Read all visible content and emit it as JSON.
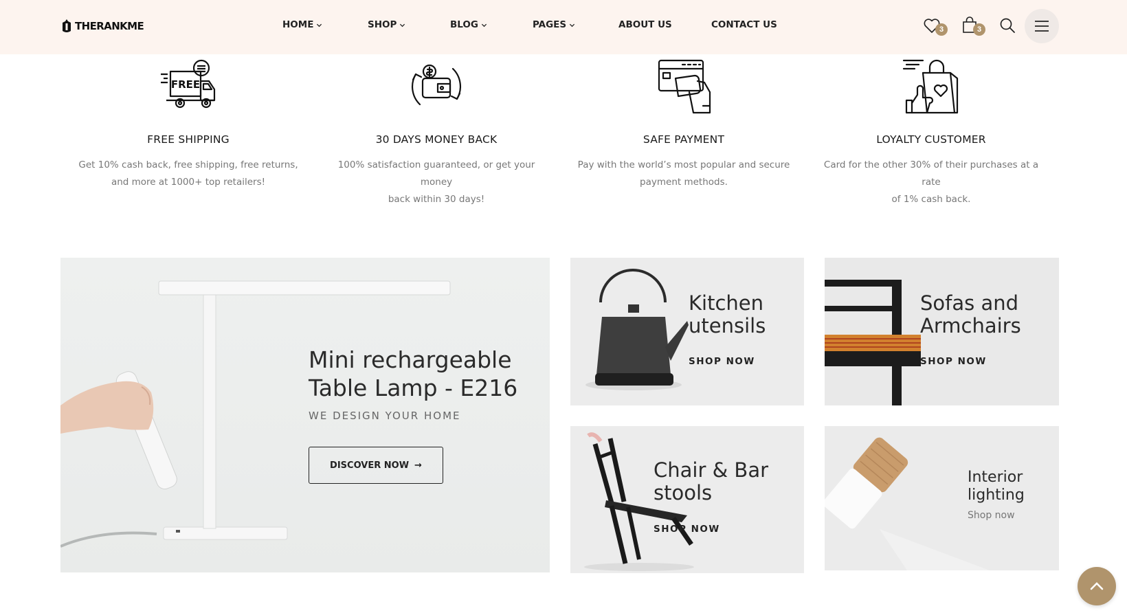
{
  "header": {
    "logo_text": "THERANKME",
    "nav": [
      {
        "label": "HOME",
        "has_dropdown": true
      },
      {
        "label": "SHOP",
        "has_dropdown": true
      },
      {
        "label": "BLOG",
        "has_dropdown": true
      },
      {
        "label": "PAGES",
        "has_dropdown": true
      },
      {
        "label": "ABOUT US",
        "has_dropdown": false
      },
      {
        "label": "CONTACT US",
        "has_dropdown": false
      }
    ],
    "wishlist_count": "3",
    "cart_count": "3",
    "accent_color": "#b0946c"
  },
  "features": [
    {
      "icon": "free-shipping-truck-icon",
      "title": "FREE SHIPPING",
      "text_line1": "Get 10% cash back, free shipping, free returns,",
      "text_line2": "and more at 1000+ top retailers!"
    },
    {
      "icon": "money-back-wallet-icon",
      "title": "30 DAYS MONEY BACK",
      "text_line1": "100% satisfaction guaranteed, or get your money",
      "text_line2": "back within 30 days!"
    },
    {
      "icon": "card-payment-icon",
      "title": "SAFE PAYMENT",
      "text_line1": "Pay with the world’s most popular and secure",
      "text_line2": "payment methods."
    },
    {
      "icon": "loyalty-bag-icon",
      "title": "LOYALTY CUSTOMER",
      "text_line1": "Card for the other 30% of their purchases at a rate",
      "text_line2": "of 1% cash back."
    }
  ],
  "truck_icon_text": "FREE",
  "banners": {
    "main": {
      "title_line1": "Mini rechargeable",
      "title_line2": "Table Lamp - E216",
      "subtitle": "WE DESIGN YOUR HOME",
      "button": "DISCOVER NOW",
      "button_arrow": "→"
    },
    "kitchen": {
      "title_line1": "Kitchen",
      "title_line2": "utensils",
      "cta": "SHOP NOW"
    },
    "sofas": {
      "title_line1": "Sofas and",
      "title_line2": "Armchairs",
      "cta": "SHOP NOW"
    },
    "chair": {
      "title_line1": "Chair & Bar",
      "title_line2": "stools",
      "cta": "SHOP NOW"
    },
    "lighting": {
      "title_line1": "Interior",
      "title_line2": "lighting",
      "cta": "Shop now"
    }
  }
}
